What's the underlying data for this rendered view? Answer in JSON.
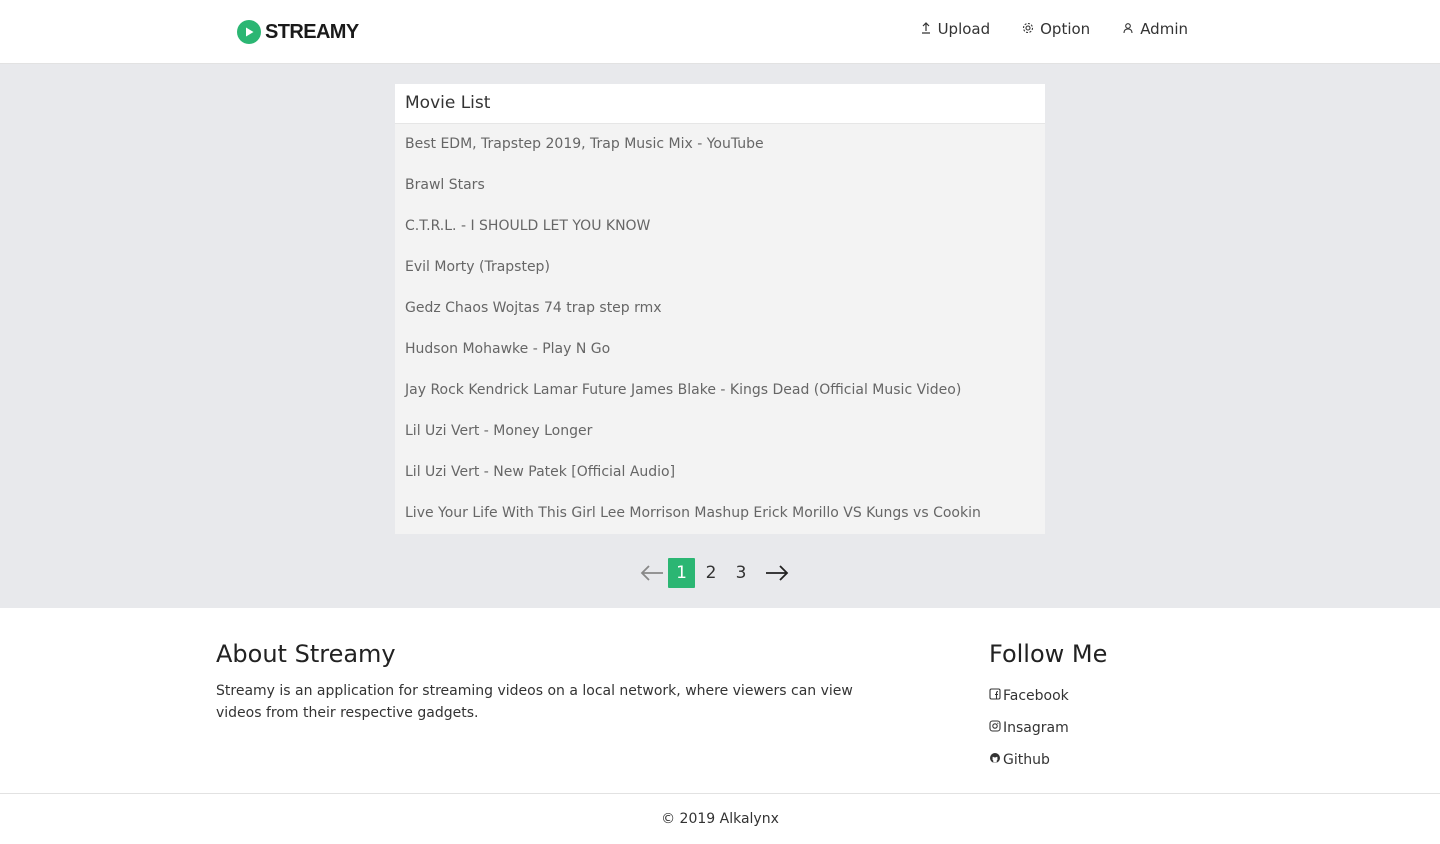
{
  "brand": {
    "name": "STREAMY",
    "accent_color": "#2bb673"
  },
  "nav": {
    "links": [
      {
        "label": "Upload",
        "icon": "upload-icon"
      },
      {
        "label": "Option",
        "icon": "gear-icon"
      },
      {
        "label": "Admin",
        "icon": "user-icon"
      }
    ]
  },
  "movie_list": {
    "title": "Movie List",
    "items": [
      "Best EDM, Trapstep 2019, Trap Music Mix - YouTube",
      "Brawl Stars",
      "C.T.R.L. - I SHOULD LET YOU KNOW",
      "Evil Morty (Trapstep)",
      "Gedz Chaos Wojtas 74 trap step rmx",
      "Hudson Mohawke - Play N Go",
      "Jay Rock Kendrick Lamar Future James Blake - Kings Dead (Official Music Video)",
      "Lil Uzi Vert - Money Longer",
      "Lil Uzi Vert - New Patek [Official Audio]",
      "Live Your Life With This Girl Lee Morrison Mashup Erick Morillo VS Kungs vs Cookin"
    ]
  },
  "pagination": {
    "pages": [
      "1",
      "2",
      "3"
    ],
    "current": "1"
  },
  "footer": {
    "about_title": "About Streamy",
    "about_text": "Streamy is an application for streaming videos on a local network, where viewers can view videos from their respective gadgets.",
    "follow_title": "Follow Me",
    "follow_links": [
      {
        "label": "Facebook",
        "icon": "facebook-icon"
      },
      {
        "label": "Insagram",
        "icon": "instagram-icon"
      },
      {
        "label": "Github",
        "icon": "github-icon"
      }
    ],
    "copyright": "© 2019 Alkalynx"
  }
}
